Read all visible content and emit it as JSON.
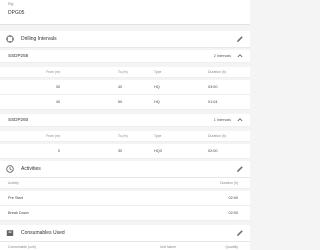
{
  "rig": {
    "label": "Rig",
    "value": "DPG05"
  },
  "drilling": {
    "title": "Drilling Intervals",
    "groups": [
      {
        "name": "SSDP258",
        "count": "2 intervals",
        "headers": {
          "from": "From (m)",
          "to": "To (m)",
          "type": "Type",
          "duration": "Duration (h)"
        },
        "rows": [
          {
            "from": "30",
            "to": "40",
            "type": "HQ",
            "duration": "03:00"
          },
          {
            "from": "40",
            "to": "50",
            "type": "HQ",
            "duration": "01:04"
          }
        ]
      },
      {
        "name": "SSDP260",
        "count": "1 intervals",
        "headers": {
          "from": "From (m)",
          "to": "To (m)",
          "type": "Type",
          "duration": "Duration (h)"
        },
        "rows": [
          {
            "from": "0",
            "to": "30",
            "type": "HQ3",
            "duration": "02:00"
          }
        ]
      }
    ]
  },
  "activities": {
    "title": "Activities",
    "headers": {
      "activity": "Activity",
      "duration": "Duration (h)"
    },
    "rows": [
      {
        "activity": "Pre Start",
        "duration": "02:00"
      },
      {
        "activity": "Break Down",
        "duration": "02:00"
      }
    ]
  },
  "consumables": {
    "title": "Consumables Used",
    "headers": {
      "consumable": "Consumable (unit)",
      "unit_name": "Unit Name",
      "quantity": "Quantity"
    }
  },
  "icons": {
    "drilling": "drill-icon",
    "activities": "clock-icon",
    "consumables": "box-icon",
    "edit": "pencil-icon",
    "collapse": "chevron-up-icon"
  }
}
